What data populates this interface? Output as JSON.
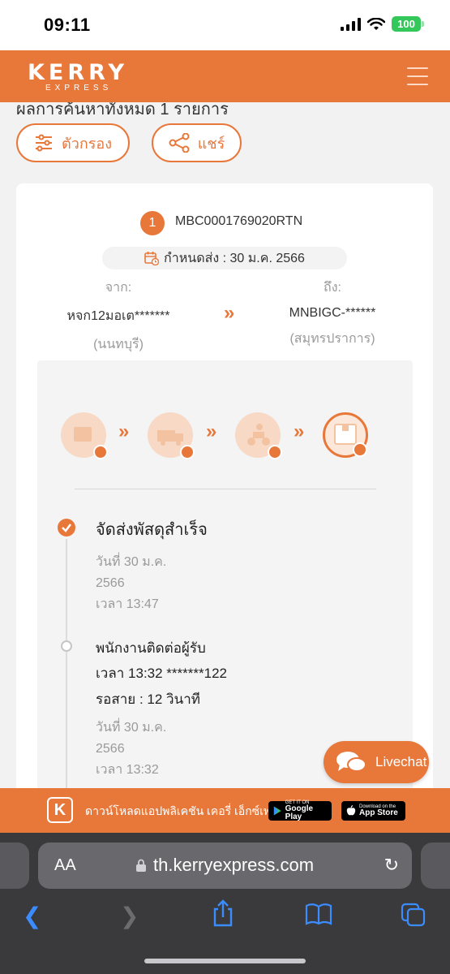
{
  "status_bar": {
    "time": "09:11",
    "battery": "100"
  },
  "header": {
    "logo_main": "KERRY",
    "logo_sub": "EXPRESS"
  },
  "results": {
    "title": "ผลการค้นหาทั้งหมด 1 รายการ",
    "filter_label": "ตัวกรอง",
    "share_label": "แชร์"
  },
  "shipment": {
    "index": "1",
    "tracking_number": "MBC0001769020RTN",
    "due_date": "กำหนดส่ง : 30 ม.ค. 2566",
    "from": {
      "label": "จาก:",
      "code": "หจก12มอเต*******",
      "province": "(นนทบุรี)"
    },
    "to": {
      "label": "ถึง:",
      "code": "MNBIGC-******",
      "province": "(สมุทรปราการ)"
    }
  },
  "timeline": [
    {
      "title": "จัดส่งพัสดุสำเร็จ",
      "date": "วันที่ 30 ม.ค.",
      "year": "2566",
      "time": "เวลา 13:47"
    },
    {
      "title": "พนักงานติดต่อผู้รับ",
      "line1": "เวลา 13:32 *******122",
      "line2": "รอสาย : 12 วินาที",
      "date": "วันที่ 30 ม.ค.",
      "year": "2566",
      "time": "เวลา 13:32"
    }
  ],
  "livechat": {
    "label": "Livechat"
  },
  "app_banner": {
    "text": "ดาวน์โหลดแอปพลิเคชัน เคอรี่ เอ็กซ์เพรส",
    "google_small": "GET IT ON",
    "google_big": "Google Play",
    "apple_small": "Download on the",
    "apple_big": "App Store"
  },
  "browser": {
    "aa_label": "AA",
    "url": "th.kerryexpress.com"
  },
  "colors": {
    "brand": "#e8773a",
    "success": "#34c759",
    "toolbar": "#3a3a3c"
  }
}
